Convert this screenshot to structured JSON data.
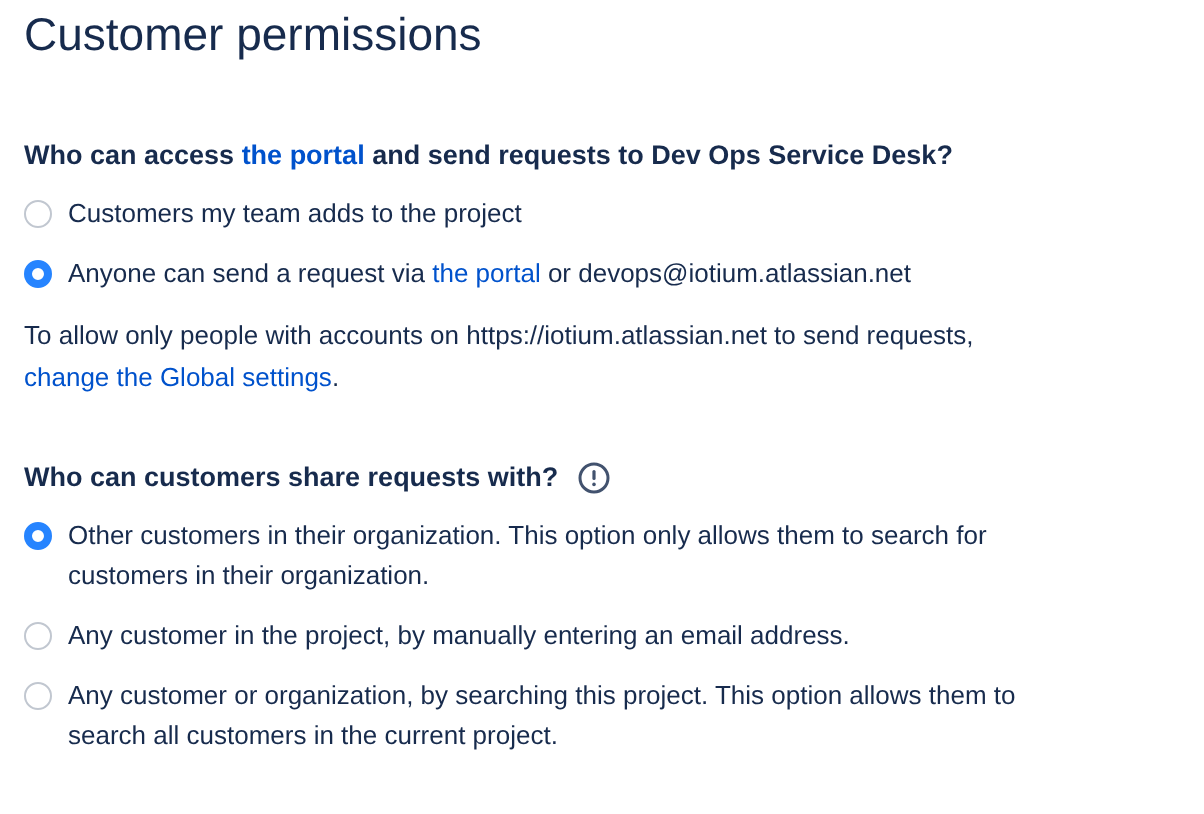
{
  "title": "Customer permissions",
  "sections": [
    {
      "question": [
        {
          "text": "Who can access "
        },
        {
          "text": "the portal",
          "link": true
        },
        {
          "text": " and send requests to Dev Ops Service Desk?"
        }
      ],
      "info_icon": false,
      "options": [
        {
          "selected": false,
          "label": [
            {
              "text": "Customers my team adds to the project"
            }
          ]
        },
        {
          "selected": true,
          "label": [
            {
              "text": "Anyone can send a request via "
            },
            {
              "text": "the portal",
              "link": true
            },
            {
              "text": " or devops@iotium.atlassian.net"
            }
          ]
        }
      ],
      "note": [
        {
          "text": "To allow only people with accounts on https://iotium.atlassian.net to send requests, "
        },
        {
          "text": "change the Global settings",
          "link": true
        },
        {
          "text": "."
        }
      ]
    },
    {
      "question": [
        {
          "text": "Who can customers share requests with?"
        }
      ],
      "info_icon": true,
      "options": [
        {
          "selected": true,
          "label": [
            {
              "text": "Other customers in their organization. This option only allows them to search for customers in their organization."
            }
          ]
        },
        {
          "selected": false,
          "label": [
            {
              "text": "Any customer in the project, by manually entering an email address."
            }
          ]
        },
        {
          "selected": false,
          "label": [
            {
              "text": "Any customer or organization, by searching this project. This option allows them to search all customers in the current project."
            }
          ]
        }
      ]
    }
  ]
}
